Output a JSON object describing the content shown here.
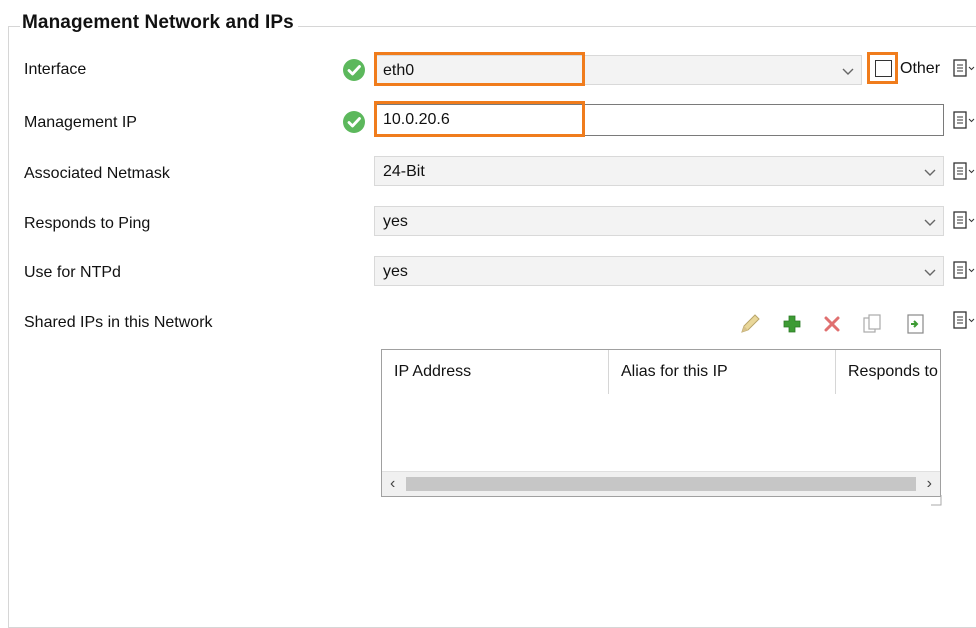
{
  "section": {
    "title": "Management Network and IPs"
  },
  "fields": {
    "interface": {
      "label": "Interface",
      "value": "eth0",
      "other_label": "Other",
      "other_checked": false
    },
    "management_ip": {
      "label": "Management IP",
      "value": "10.0.20.6"
    },
    "netmask": {
      "label": "Associated Netmask",
      "value": "24-Bit"
    },
    "ping": {
      "label": "Responds to Ping",
      "value": "yes"
    },
    "ntpd": {
      "label": "Use for NTPd",
      "value": "yes"
    },
    "shared_ips": {
      "label": "Shared IPs in this Network"
    }
  },
  "table": {
    "columns": [
      "IP Address",
      "Alias for this IP",
      "Responds to"
    ]
  },
  "colors": {
    "highlight": "#f07c1c",
    "valid": "#5cb85c"
  },
  "icons": [
    "check-icon",
    "dropdown-arrow-icon",
    "clipboard-icon",
    "edit-pencil-icon",
    "add-icon",
    "delete-icon",
    "copy-icon",
    "paste-icon"
  ]
}
